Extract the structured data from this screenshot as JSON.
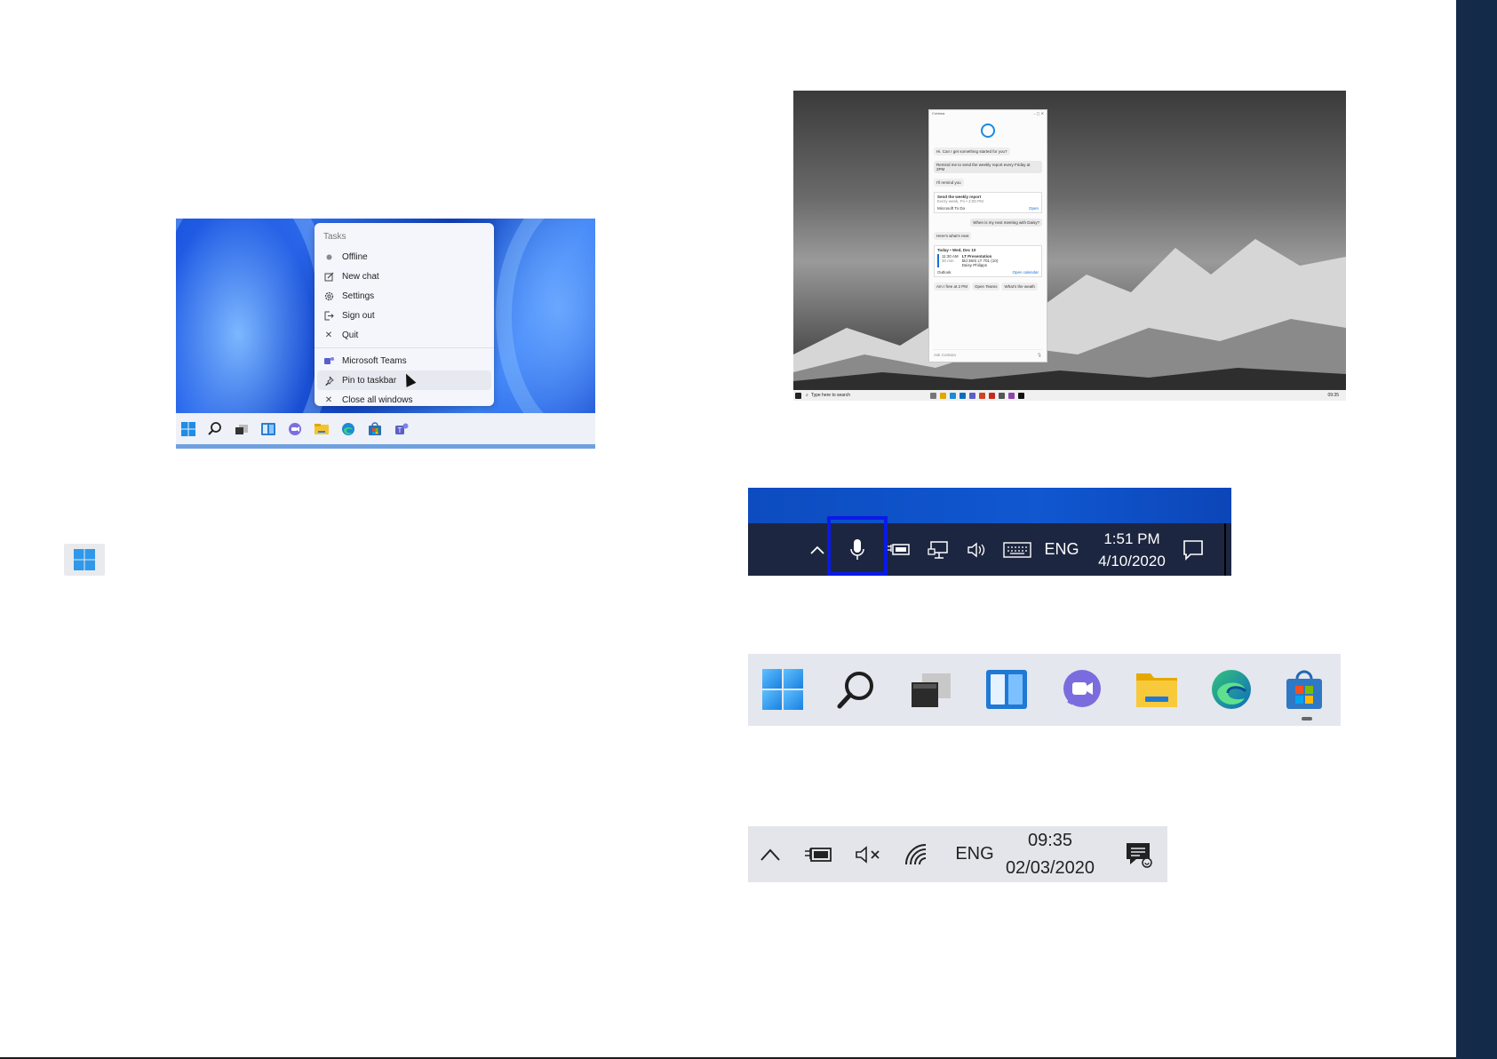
{
  "teams_jumplist": {
    "header": "Tasks",
    "items": [
      {
        "label": "Offline",
        "icon": "status-dot-icon"
      },
      {
        "label": "New chat",
        "icon": "compose-icon"
      },
      {
        "label": "Settings",
        "icon": "gear-icon"
      },
      {
        "label": "Sign out",
        "icon": "sign-out-icon"
      },
      {
        "label": "Quit",
        "icon": "close-icon"
      }
    ],
    "pinned": [
      {
        "label": "Microsoft Teams",
        "icon": "teams-icon"
      },
      {
        "label": "Pin to taskbar",
        "icon": "pin-icon"
      },
      {
        "label": "Close all windows",
        "icon": "close-icon"
      }
    ],
    "taskbar_icons": [
      "start-icon",
      "search-icon",
      "task-view-icon",
      "widgets-icon",
      "chat-icon",
      "file-explorer-icon",
      "edge-icon",
      "store-icon",
      "teams-icon"
    ]
  },
  "cortana": {
    "greeting": "Hi. Can I get something started for you?",
    "user_msg1": "Remind me to send the weekly report every Friday at 2PM",
    "reply1": "I'll remind you",
    "reminder_title": "Send the weekly report",
    "reminder_sub": "Every week, Fri • 2:00 PM",
    "reminder_app": "Microsoft To Do",
    "reminder_open": "Open",
    "user_msg2": "When is my next meeting with Daisy?",
    "reply2": "Here's what's next",
    "day_header": "Today • Wed, Dec 10",
    "meeting_time": "11:30 AM",
    "meeting_dur": "30 min",
    "meeting_title": "LT Presentation",
    "meeting_loc": "bld 36/S LT 701 (10)",
    "meeting_person": "Daisy Philipps",
    "meeting_app": "Outlook",
    "meeting_link": "Open calendar",
    "chips": [
      "Am I free at 2 PM",
      "Open Teams",
      "What's the weath"
    ],
    "ask_placeholder": "Ask Cortana",
    "taskbar_search": "Type here to search",
    "taskbar_time": "09:35"
  },
  "win10_tray": {
    "language": "ENG",
    "time": "1:51 PM",
    "date": "4/10/2020"
  },
  "win11_taskbar": {
    "icons": [
      "start-icon",
      "search-icon",
      "task-view-icon",
      "widgets-icon",
      "chat-icon",
      "file-explorer-icon",
      "edge-icon",
      "store-icon"
    ]
  },
  "win11_tray": {
    "language": "ENG",
    "time": "09:35",
    "date": "02/03/2020"
  },
  "colors": {
    "side_band": "#142a49",
    "win_blue": "#1a8ae6",
    "highlight_box": "#0a1ae8"
  }
}
